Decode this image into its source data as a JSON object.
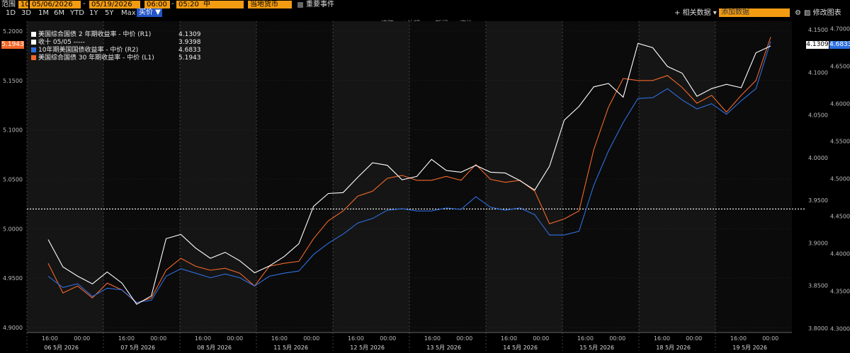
{
  "toolbar": {
    "range_label": "范围",
    "range_num": "10",
    "date_from": "05/06/2026",
    "date_sep": "-",
    "date_to": "05/19/2026",
    "time_from": "06:00",
    "time_sep": "-",
    "time_to": "05:20",
    "mid": "中",
    "currency": "当地货币",
    "events": "重要事件",
    "periods": [
      "1D",
      "3D",
      "1M",
      "6M",
      "YTD",
      "1Y",
      "5Y",
      "Max"
    ],
    "price_mode": "买价 ▼",
    "related_data": "+ 相关数据 ▾",
    "add_data": "添加数据",
    "edit_chart": "修改图表",
    "tools": [
      "追踪",
      "注释",
      "新闻",
      "缩放"
    ]
  },
  "legend": [
    {
      "label": "美国综合国债 2 年期收益率 - 中价 (R1)",
      "value": "4.1309",
      "color": "#ffffff"
    },
    {
      "label": "收十 05/05 -----",
      "value": "3.9398",
      "color": "#ffffff"
    },
    {
      "label": "10年期美国国债收益率 - 中价 (R2)",
      "value": "4.6833",
      "color": "#2e6fe0"
    },
    {
      "label": "美国综合国债 30 年期收益率 - 中价 (L1)",
      "value": "5.1943",
      "color": "#f2682a"
    }
  ],
  "axis_badges": {
    "left_value": "5.1943",
    "r1_value": "4.1309",
    "r2_value": "4.6833"
  },
  "chart_data": {
    "type": "line",
    "x_day_labels": [
      "06 5月 2026",
      "07 5月 2026",
      "08 5月 2026",
      "11 5月 2026",
      "12 5月 2026",
      "13 5月 2026",
      "14 5月 2026",
      "15 5月 2026",
      "18 5月 2026",
      "19 5月 2026"
    ],
    "x_tick_labels": [
      "16:00",
      "00:00"
    ],
    "y_left": {
      "ticks": [
        "4.9000",
        "4.9500",
        "5.0000",
        "5.0500",
        "5.1000",
        "5.1500",
        "5.2000"
      ],
      "range": [
        4.895,
        5.21
      ]
    },
    "y_r1": {
      "ticks": [
        "3.8000",
        "3.8500",
        "3.9000",
        "3.9500",
        "4.0000",
        "4.0500",
        "4.1000",
        "4.1500"
      ],
      "range": [
        3.795,
        4.16
      ]
    },
    "y_r2": {
      "ticks": [
        "4.3000",
        "4.3500",
        "4.4000",
        "4.4500",
        "4.5000",
        "4.5500",
        "4.6000",
        "4.6500",
        "4.7000"
      ],
      "range": [
        4.295,
        4.71
      ]
    },
    "reference_line": {
      "name": "收十 05/05",
      "value": 3.9398,
      "axis": "r1"
    },
    "series": [
      {
        "name": "美国综合国债 2 年期收益率 - 中价 (R1)",
        "axis": "r1",
        "color": "#ffffff",
        "values": [
          3.904,
          3.872,
          3.861,
          3.852,
          3.866,
          3.853,
          3.828,
          3.838,
          3.905,
          3.91,
          3.894,
          3.882,
          3.889,
          3.879,
          3.865,
          3.873,
          3.884,
          3.899,
          3.943,
          3.958,
          3.959,
          3.977,
          3.994,
          3.991,
          3.974,
          3.978,
          3.998,
          3.985,
          3.983,
          3.991,
          3.983,
          3.982,
          3.973,
          3.962,
          3.99,
          4.044,
          4.06,
          4.083,
          4.087,
          4.071,
          4.134,
          4.129,
          4.107,
          4.099,
          4.072,
          4.081,
          4.086,
          4.082,
          4.123,
          4.131
        ]
      },
      {
        "name": "10年期美国国债收益率 - 中价 (R2)",
        "axis": "r2",
        "color": "#2e6fe0",
        "values": [
          4.37,
          4.355,
          4.36,
          4.343,
          4.354,
          4.352,
          4.335,
          4.338,
          4.37,
          4.38,
          4.374,
          4.368,
          4.373,
          4.368,
          4.357,
          4.37,
          4.374,
          4.377,
          4.399,
          4.414,
          4.426,
          4.441,
          4.447,
          4.458,
          4.46,
          4.457,
          4.457,
          4.461,
          4.459,
          4.476,
          4.462,
          4.458,
          4.461,
          4.452,
          4.425,
          4.425,
          4.43,
          4.491,
          4.537,
          4.575,
          4.607,
          4.608,
          4.62,
          4.605,
          4.593,
          4.6,
          4.586,
          4.604,
          4.62,
          4.683
        ]
      },
      {
        "name": "美国综合国债 30 年期收益率 - 中价 (L1)",
        "axis": "left",
        "color": "#f2682a",
        "values": [
          4.965,
          4.935,
          4.942,
          4.93,
          4.945,
          4.938,
          4.925,
          4.93,
          4.958,
          4.97,
          4.962,
          4.958,
          4.96,
          4.955,
          4.942,
          4.962,
          4.965,
          4.967,
          4.99,
          5.008,
          5.018,
          5.033,
          5.038,
          5.051,
          5.054,
          5.049,
          5.049,
          5.053,
          5.049,
          5.065,
          5.05,
          5.047,
          5.049,
          5.038,
          5.005,
          5.01,
          5.018,
          5.08,
          5.123,
          5.152,
          5.15,
          5.15,
          5.155,
          5.143,
          5.127,
          5.135,
          5.118,
          5.135,
          5.15,
          5.194
        ]
      }
    ]
  }
}
